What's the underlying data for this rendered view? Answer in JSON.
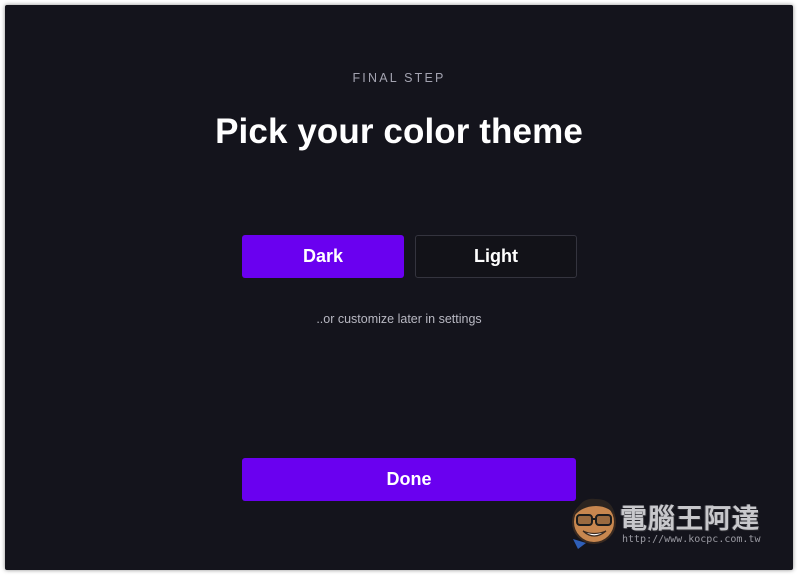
{
  "onboarding": {
    "step_label": "FINAL STEP",
    "title": "Pick your color theme",
    "options": [
      {
        "label": "Dark",
        "selected": true
      },
      {
        "label": "Light",
        "selected": false
      }
    ],
    "hint": "..or customize later in settings",
    "done_label": "Done"
  },
  "watermark": {
    "text": "電腦王阿達",
    "url": "http://www.kocpc.com.tw"
  },
  "colors": {
    "background": "#14141c",
    "accent": "#6a00f0",
    "unselected_button": "#121218",
    "text_primary": "#ffffff",
    "text_muted": "#a3a3b0"
  }
}
